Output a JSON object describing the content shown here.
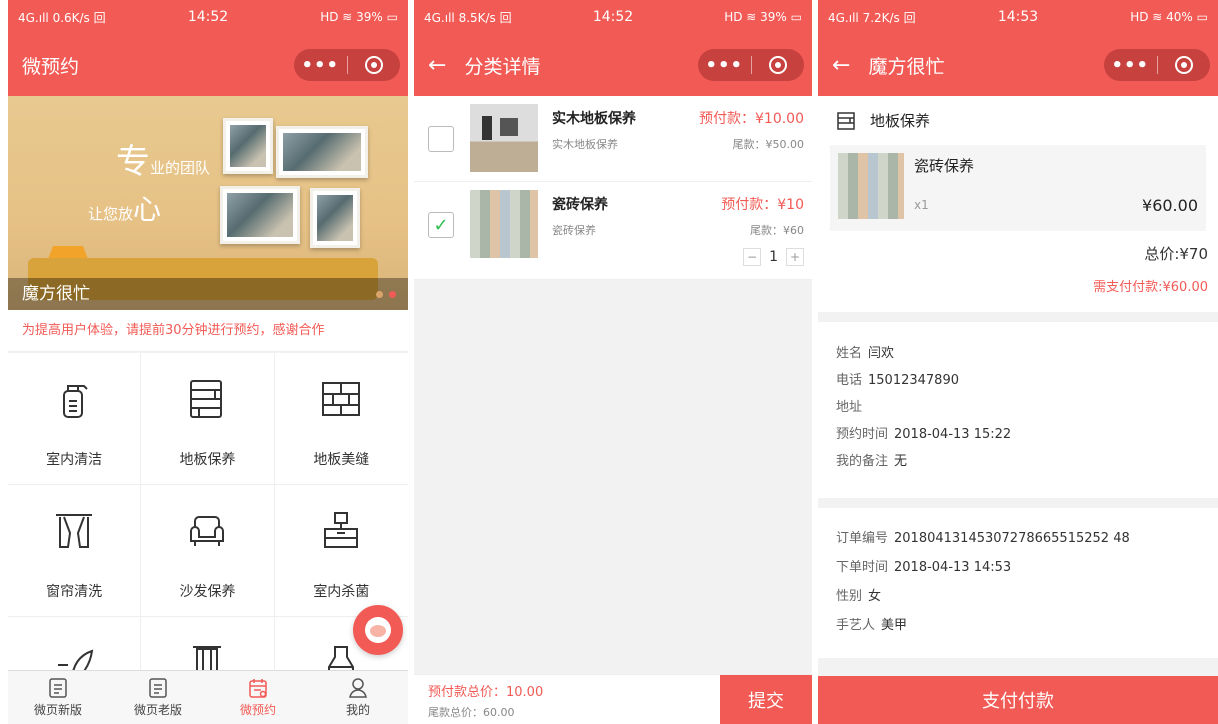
{
  "screen1": {
    "status": {
      "left": "4G.ıll 0.6K/s 回",
      "time": "14:52",
      "right": "HD ≋ 39% ▭"
    },
    "title": "微预约",
    "capsule_dots": "•••",
    "banner": {
      "caption": "魔方很忙",
      "big1": "专",
      "small1": "业的团队",
      "small2": "让您放",
      "big2": "心"
    },
    "notice": "为提高用户体验，请提前30分钟进行预约，感谢合作",
    "services": [
      {
        "label": "室内清洁",
        "icon": "spray-bottle-icon"
      },
      {
        "label": "地板保养",
        "icon": "floor-planks-icon"
      },
      {
        "label": "地板美缝",
        "icon": "tile-grid-icon"
      },
      {
        "label": "窗帘清洗",
        "icon": "curtain-icon"
      },
      {
        "label": "沙发保养",
        "icon": "sofa-icon"
      },
      {
        "label": "室内杀菌",
        "icon": "cabinet-icon"
      },
      {
        "label": "",
        "icon": "leaf-icon"
      },
      {
        "label": "",
        "icon": "pillar-icon"
      },
      {
        "label": "",
        "icon": "bottle-icon"
      }
    ],
    "tabs": [
      {
        "label": "微页新版",
        "icon": "doc-icon",
        "active": false
      },
      {
        "label": "微页老版",
        "icon": "doc-icon",
        "active": false
      },
      {
        "label": "微预约",
        "icon": "calendar-icon",
        "active": true
      },
      {
        "label": "我的",
        "icon": "person-icon",
        "active": false
      }
    ]
  },
  "screen2": {
    "status": {
      "left": "4G.ıll 8.5K/s 回",
      "time": "14:52",
      "right": "HD ≋ 39% ▭"
    },
    "title": "分类详情",
    "items": [
      {
        "name": "实木地板保养",
        "sub": "实木地板保养",
        "deposit": "预付款：¥10.00",
        "balance": "尾款：¥50.00",
        "checked": false
      },
      {
        "name": "瓷砖保养",
        "sub": "瓷砖保养",
        "deposit": "预付款：¥10",
        "balance": "尾款：¥60",
        "checked": true,
        "qty": "1"
      }
    ],
    "total_deposit": "预付款总价：10.00",
    "total_balance": "尾款总价：60.00",
    "submit": "提交"
  },
  "screen3": {
    "status": {
      "left": "4G.ıll 7.2K/s 回",
      "time": "14:53",
      "right": "HD ≋ 40% ▭"
    },
    "title": "魔方很忙",
    "category": "地板保养",
    "product": {
      "name": "瓷砖保养",
      "qty": "x1",
      "price": "¥60.00"
    },
    "total": "总价:¥70",
    "need_pay": "需支付付款:¥60.00",
    "contact": [
      {
        "k": "姓名",
        "v": "闫欢"
      },
      {
        "k": "电话",
        "v": "15012347890"
      },
      {
        "k": "地址",
        "v": ""
      },
      {
        "k": "预约时间",
        "v": "2018-04-13 15:22"
      },
      {
        "k": "我的备注",
        "v": "无"
      }
    ],
    "order": [
      {
        "k": "订单编号",
        "v": "20180413145307278665515252 48"
      },
      {
        "k": "下单时间",
        "v": "2018-04-13 14:53"
      },
      {
        "k": "性别",
        "v": "女"
      },
      {
        "k": "手艺人",
        "v": "美甲"
      }
    ],
    "pay_button": "支付付款"
  },
  "accent_color": "#f25a55"
}
